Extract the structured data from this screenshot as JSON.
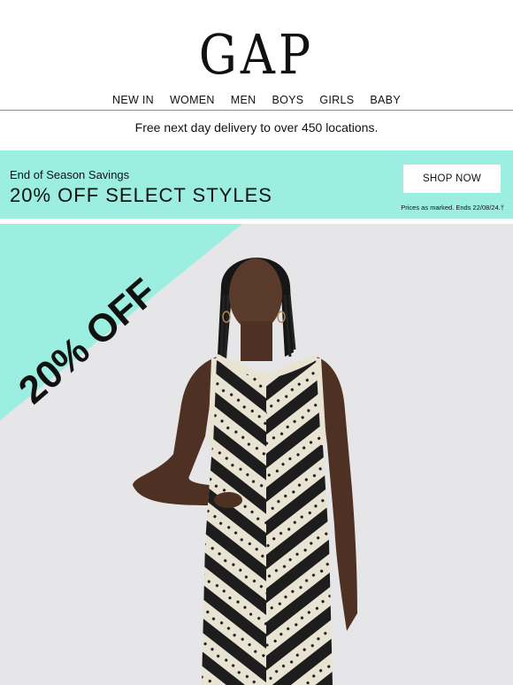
{
  "brand": {
    "logo_text": "GAP"
  },
  "nav": {
    "items": [
      "NEW IN",
      "WOMEN",
      "MEN",
      "BOYS",
      "GIRLS",
      "BABY"
    ]
  },
  "delivery": {
    "text": "Free next day delivery to over 450 locations."
  },
  "promo": {
    "subtitle": "End of Season Savings",
    "headline": "20% OFF SELECT STYLES",
    "button_label": "SHOP NOW",
    "fine_print": "Prices as marked. Ends 22/08/24.†"
  },
  "hero": {
    "corner_label": "20% OFF"
  },
  "colors": {
    "accent": "#9ceee0",
    "text": "#111111",
    "hero_bg": "#e6e6e8"
  }
}
